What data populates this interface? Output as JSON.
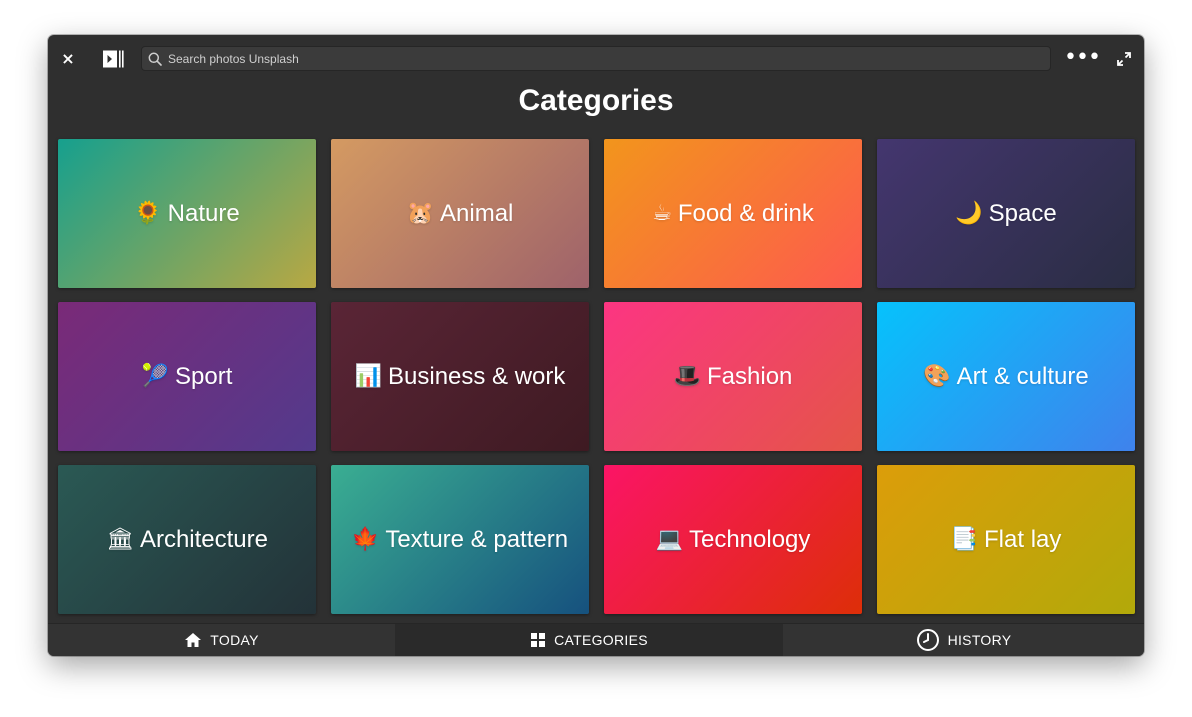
{
  "toolbar": {
    "close_icon": "close-icon",
    "close_glyph": "×",
    "logo_icon": "unsplash-app-logo",
    "search_placeholder": "Search photos Unsplash",
    "search_value": "",
    "more_icon": "ellipsis-icon",
    "more_glyph": "•••",
    "expand_icon": "expand-icon"
  },
  "page": {
    "title": "Categories"
  },
  "categories": [
    {
      "emoji": "🌻",
      "label": "Nature",
      "colors": [
        "#16a08e",
        "#b8a843"
      ]
    },
    {
      "emoji": "🐹",
      "label": "Animal",
      "colors": [
        "#d49a62",
        "#9e626a"
      ]
    },
    {
      "emoji": "☕",
      "label": "Food & drink",
      "colors": [
        "#f2951c",
        "#fd5a4e"
      ]
    },
    {
      "emoji": "🌙",
      "label": "Space",
      "colors": [
        "#44366f",
        "#2a2d43"
      ]
    },
    {
      "emoji": "🎾",
      "label": "Sport",
      "colors": [
        "#7a2a78",
        "#533a8c"
      ]
    },
    {
      "emoji": "📊",
      "label": "Business & work",
      "colors": [
        "#5a2536",
        "#3e1a22"
      ]
    },
    {
      "emoji": "🎩",
      "label": "Fashion",
      "colors": [
        "#fc3582",
        "#e45548"
      ]
    },
    {
      "emoji": "🎨",
      "label": "Art & culture",
      "colors": [
        "#06c2fc",
        "#3f82ec"
      ]
    },
    {
      "emoji": "🏛",
      "label": "Architecture",
      "colors": [
        "#2a5954",
        "#233238"
      ]
    },
    {
      "emoji": "🍁",
      "label": "Texture & pattern",
      "colors": [
        "#3aae92",
        "#16517e"
      ]
    },
    {
      "emoji": "💻",
      "label": "Technology",
      "colors": [
        "#fb1466",
        "#dd2e08"
      ]
    },
    {
      "emoji": "📑",
      "label": "Flat lay",
      "colors": [
        "#dc9d0a",
        "#b2a90a"
      ]
    }
  ],
  "nav": {
    "today": {
      "label": "TODAY",
      "icon": "home-icon"
    },
    "categories": {
      "label": "CATEGORIES",
      "icon": "grid-icon",
      "active": true
    },
    "history": {
      "label": "HISTORY",
      "icon": "clock-icon"
    }
  }
}
